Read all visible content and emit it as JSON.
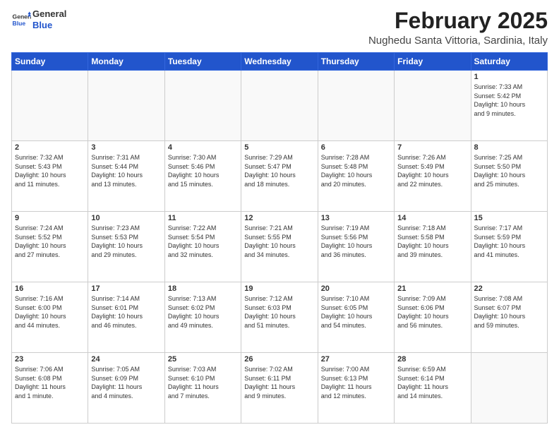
{
  "header": {
    "logo_line1": "General",
    "logo_line2": "Blue",
    "month": "February 2025",
    "location": "Nughedu Santa Vittoria, Sardinia, Italy"
  },
  "weekdays": [
    "Sunday",
    "Monday",
    "Tuesday",
    "Wednesday",
    "Thursday",
    "Friday",
    "Saturday"
  ],
  "weeks": [
    [
      {
        "day": "",
        "info": ""
      },
      {
        "day": "",
        "info": ""
      },
      {
        "day": "",
        "info": ""
      },
      {
        "day": "",
        "info": ""
      },
      {
        "day": "",
        "info": ""
      },
      {
        "day": "",
        "info": ""
      },
      {
        "day": "1",
        "info": "Sunrise: 7:33 AM\nSunset: 5:42 PM\nDaylight: 10 hours\nand 9 minutes."
      }
    ],
    [
      {
        "day": "2",
        "info": "Sunrise: 7:32 AM\nSunset: 5:43 PM\nDaylight: 10 hours\nand 11 minutes."
      },
      {
        "day": "3",
        "info": "Sunrise: 7:31 AM\nSunset: 5:44 PM\nDaylight: 10 hours\nand 13 minutes."
      },
      {
        "day": "4",
        "info": "Sunrise: 7:30 AM\nSunset: 5:46 PM\nDaylight: 10 hours\nand 15 minutes."
      },
      {
        "day": "5",
        "info": "Sunrise: 7:29 AM\nSunset: 5:47 PM\nDaylight: 10 hours\nand 18 minutes."
      },
      {
        "day": "6",
        "info": "Sunrise: 7:28 AM\nSunset: 5:48 PM\nDaylight: 10 hours\nand 20 minutes."
      },
      {
        "day": "7",
        "info": "Sunrise: 7:26 AM\nSunset: 5:49 PM\nDaylight: 10 hours\nand 22 minutes."
      },
      {
        "day": "8",
        "info": "Sunrise: 7:25 AM\nSunset: 5:50 PM\nDaylight: 10 hours\nand 25 minutes."
      }
    ],
    [
      {
        "day": "9",
        "info": "Sunrise: 7:24 AM\nSunset: 5:52 PM\nDaylight: 10 hours\nand 27 minutes."
      },
      {
        "day": "10",
        "info": "Sunrise: 7:23 AM\nSunset: 5:53 PM\nDaylight: 10 hours\nand 29 minutes."
      },
      {
        "day": "11",
        "info": "Sunrise: 7:22 AM\nSunset: 5:54 PM\nDaylight: 10 hours\nand 32 minutes."
      },
      {
        "day": "12",
        "info": "Sunrise: 7:21 AM\nSunset: 5:55 PM\nDaylight: 10 hours\nand 34 minutes."
      },
      {
        "day": "13",
        "info": "Sunrise: 7:19 AM\nSunset: 5:56 PM\nDaylight: 10 hours\nand 36 minutes."
      },
      {
        "day": "14",
        "info": "Sunrise: 7:18 AM\nSunset: 5:58 PM\nDaylight: 10 hours\nand 39 minutes."
      },
      {
        "day": "15",
        "info": "Sunrise: 7:17 AM\nSunset: 5:59 PM\nDaylight: 10 hours\nand 41 minutes."
      }
    ],
    [
      {
        "day": "16",
        "info": "Sunrise: 7:16 AM\nSunset: 6:00 PM\nDaylight: 10 hours\nand 44 minutes."
      },
      {
        "day": "17",
        "info": "Sunrise: 7:14 AM\nSunset: 6:01 PM\nDaylight: 10 hours\nand 46 minutes."
      },
      {
        "day": "18",
        "info": "Sunrise: 7:13 AM\nSunset: 6:02 PM\nDaylight: 10 hours\nand 49 minutes."
      },
      {
        "day": "19",
        "info": "Sunrise: 7:12 AM\nSunset: 6:03 PM\nDaylight: 10 hours\nand 51 minutes."
      },
      {
        "day": "20",
        "info": "Sunrise: 7:10 AM\nSunset: 6:05 PM\nDaylight: 10 hours\nand 54 minutes."
      },
      {
        "day": "21",
        "info": "Sunrise: 7:09 AM\nSunset: 6:06 PM\nDaylight: 10 hours\nand 56 minutes."
      },
      {
        "day": "22",
        "info": "Sunrise: 7:08 AM\nSunset: 6:07 PM\nDaylight: 10 hours\nand 59 minutes."
      }
    ],
    [
      {
        "day": "23",
        "info": "Sunrise: 7:06 AM\nSunset: 6:08 PM\nDaylight: 11 hours\nand 1 minute."
      },
      {
        "day": "24",
        "info": "Sunrise: 7:05 AM\nSunset: 6:09 PM\nDaylight: 11 hours\nand 4 minutes."
      },
      {
        "day": "25",
        "info": "Sunrise: 7:03 AM\nSunset: 6:10 PM\nDaylight: 11 hours\nand 7 minutes."
      },
      {
        "day": "26",
        "info": "Sunrise: 7:02 AM\nSunset: 6:11 PM\nDaylight: 11 hours\nand 9 minutes."
      },
      {
        "day": "27",
        "info": "Sunrise: 7:00 AM\nSunset: 6:13 PM\nDaylight: 11 hours\nand 12 minutes."
      },
      {
        "day": "28",
        "info": "Sunrise: 6:59 AM\nSunset: 6:14 PM\nDaylight: 11 hours\nand 14 minutes."
      },
      {
        "day": "",
        "info": ""
      }
    ]
  ]
}
